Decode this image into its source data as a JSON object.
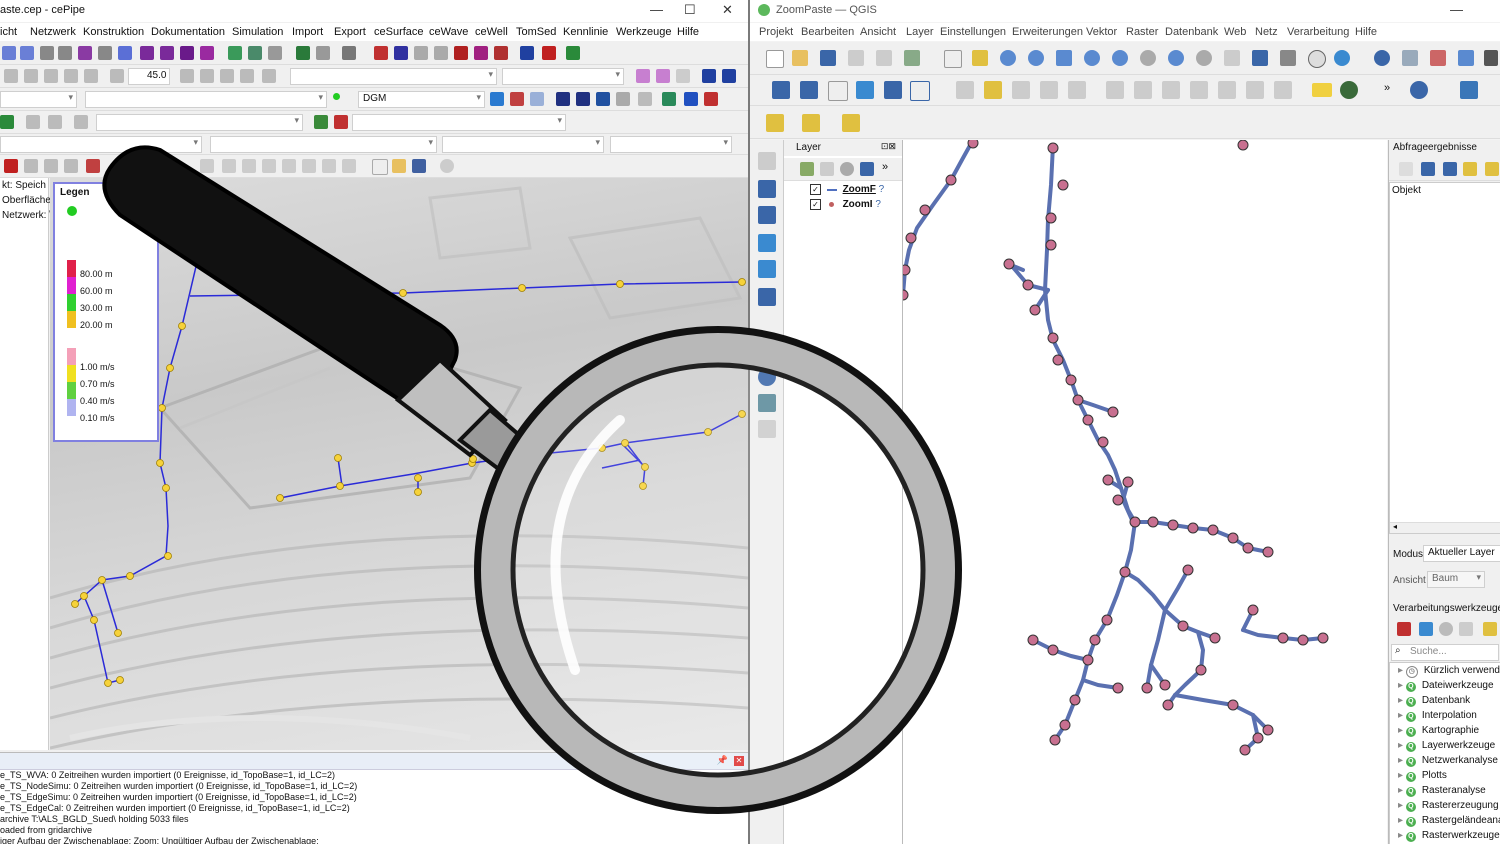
{
  "cepipe": {
    "title": "aste.cep - cePipe",
    "menu": [
      "icht",
      "Netzwerk",
      "Konstruktion",
      "Dokumentation",
      "Simulation",
      "Import",
      "Export",
      "ceSurface",
      "ceWave",
      "ceWell",
      "TomSed",
      "Kennlinie",
      "Werkzeuge",
      "Hilfe"
    ],
    "zoom_value": "45.0",
    "dgm_combo": "DGM",
    "left_panel": [
      "kt: Speich",
      "Oberfläche",
      "Netzwerk: \\"
    ],
    "legend": {
      "title": "Legen",
      "height_items": [
        "80.00 m",
        "60.00 m",
        "30.00 m",
        "20.00 m"
      ],
      "velocity_items": [
        "1.00 m/s",
        "0.70 m/s",
        "0.40 m/s",
        "0.10 m/s"
      ]
    },
    "log_lines": [
      "e_TS_WVA: 0 Zeitreihen wurden importiert (0 Ereignisse, id_TopoBase=1, id_LC=2)",
      "e_TS_NodeSimu: 0 Zeitreihen wurden importiert (0 Ereignisse, id_TopoBase=1, id_LC=2)",
      "e_TS_EdgeSimu: 0 Zeitreihen wurden importiert (0 Ereignisse, id_TopoBase=1, id_LC=2)",
      "e_TS_EdgeCal: 0 Zeitreihen wurden importiert (0 Ereignisse, id_TopoBase=1, id_LC=2)",
      "archive T:\\ALS_BGLD_Sued\\ holding 5033 files",
      "oaded from gridarchive",
      "iger Aufbau der Zwischenablage: Zoom: Ungültiger Aufbau der Zwischenablage:"
    ]
  },
  "qgis": {
    "title": "ZoomPaste — QGIS",
    "menu": [
      "Projekt",
      "Bearbeiten",
      "Ansicht",
      "Layer",
      "Einstellungen",
      "Erweiterungen",
      "Vektor",
      "Raster",
      "Datenbank",
      "Web",
      "Netz",
      "Verarbeitung",
      "Hilfe"
    ],
    "layer_panel_title": "Layer",
    "layers": [
      "ZoomF",
      "ZoomI"
    ],
    "query_title": "Abfrageergebnisse",
    "object_col": "Objekt",
    "mode_label": "Modus",
    "mode_value": "Aktueller Layer",
    "view_label": "Ansicht",
    "view_value": "Baum",
    "processing_title": "Verarbeitungswerkzeuge",
    "search_placeholder": "Suche...",
    "tools": [
      "Kürzlich verwendet",
      "Dateiwerkzeuge",
      "Datenbank",
      "Interpolation",
      "Kartographie",
      "Layerwerkzeuge",
      "Netzwerkanalyse",
      "Plotts",
      "Rasteranalyse",
      "Rastererzeugung",
      "Rastergeländeanalyse",
      "Rasterwerkzeuge"
    ]
  }
}
